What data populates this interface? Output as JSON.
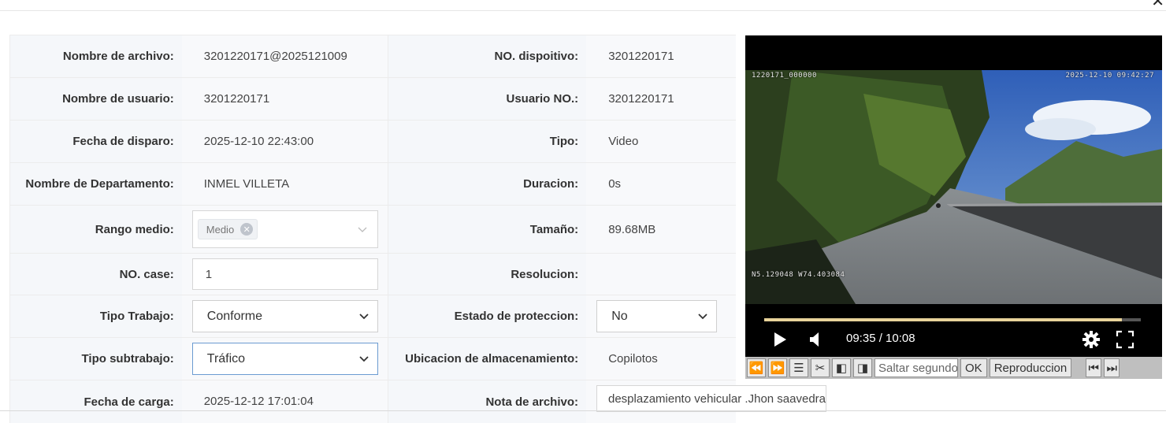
{
  "form": {
    "rows": [
      {
        "l1": "Nombre de archivo:",
        "v1": "3201220171@2025121009",
        "l2": "NO. dispoitivo:",
        "v2": "3201220171"
      },
      {
        "l1": "Nombre de usuario:",
        "v1": "3201220171",
        "l2": "Usuario NO.:",
        "v2": "3201220171"
      },
      {
        "l1": "Fecha de disparo:",
        "v1": "2025-12-10 22:43:00",
        "l2": "Tipo:",
        "v2": "Video"
      },
      {
        "l1": "Nombre de Departamento:",
        "v1": "INMEL VILLETA",
        "l2": "Duracion:",
        "v2": "0s"
      },
      {
        "l1": "Rango medio:",
        "v1_tag": "Medio",
        "l2": "Tamaño:",
        "v2": "89.68MB"
      },
      {
        "l1": "NO. case:",
        "v1_input": "1",
        "l2": "Resolucion:",
        "v2": ""
      },
      {
        "l1": "Tipo Trabajo:",
        "v1_select": "Conforme",
        "l2": "Estado de proteccion:",
        "v2_select": "No"
      },
      {
        "l1": "Tipo subtrabajo:",
        "v1_select": "Tráfico",
        "l2": "Ubicacion de almacenamiento:",
        "v2": "Copilotos"
      },
      {
        "l1": "Fecha de carga:",
        "v1": "2025-12-12 17:01:04",
        "l2": "Nota de archivo:",
        "v2_note": "desplazamiento vehicular .Jhon saavedra"
      }
    ]
  },
  "video": {
    "osd_left": "1220171_000000",
    "osd_right": "2025-12-10 09:42:27",
    "osd_gps": "N5.129048 W74.403084",
    "time": "09:35 / 10:08",
    "progress": 0.95
  },
  "toolbar": {
    "jump_placeholder": "Saltar segundo",
    "ok_label": "OK",
    "play_label": "Reproduccion"
  },
  "colors": {
    "accent_border": "#6b9bd1",
    "label_bg": "#f5f7fa",
    "progress": "#e8d39a"
  }
}
